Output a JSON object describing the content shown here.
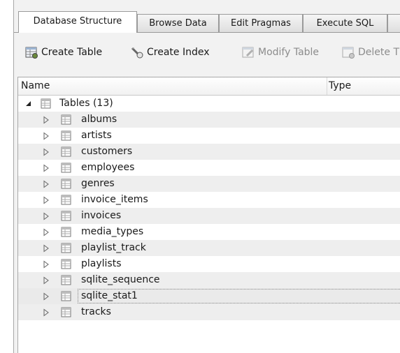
{
  "tabs": [
    {
      "label": "Database Structure",
      "active": true
    },
    {
      "label": "Browse Data",
      "active": false
    },
    {
      "label": "Edit Pragmas",
      "active": false
    },
    {
      "label": "Execute SQL",
      "active": false
    }
  ],
  "toolbar": {
    "create_table": "Create Table",
    "create_index": "Create Index",
    "modify_table": "Modify Table",
    "delete_table": "Delete T"
  },
  "tree": {
    "columns": {
      "name": "Name",
      "type": "Type"
    },
    "root_label": "Tables (13)",
    "tables": [
      "albums",
      "artists",
      "customers",
      "employees",
      "genres",
      "invoice_items",
      "invoices",
      "media_types",
      "playlist_track",
      "playlists",
      "sqlite_sequence",
      "sqlite_stat1",
      "tracks"
    ],
    "selected_table": "sqlite_stat1"
  },
  "icons": {
    "expanded": "triangle-down-icon",
    "collapsed": "triangle-right-icon",
    "table": "table-icon"
  }
}
